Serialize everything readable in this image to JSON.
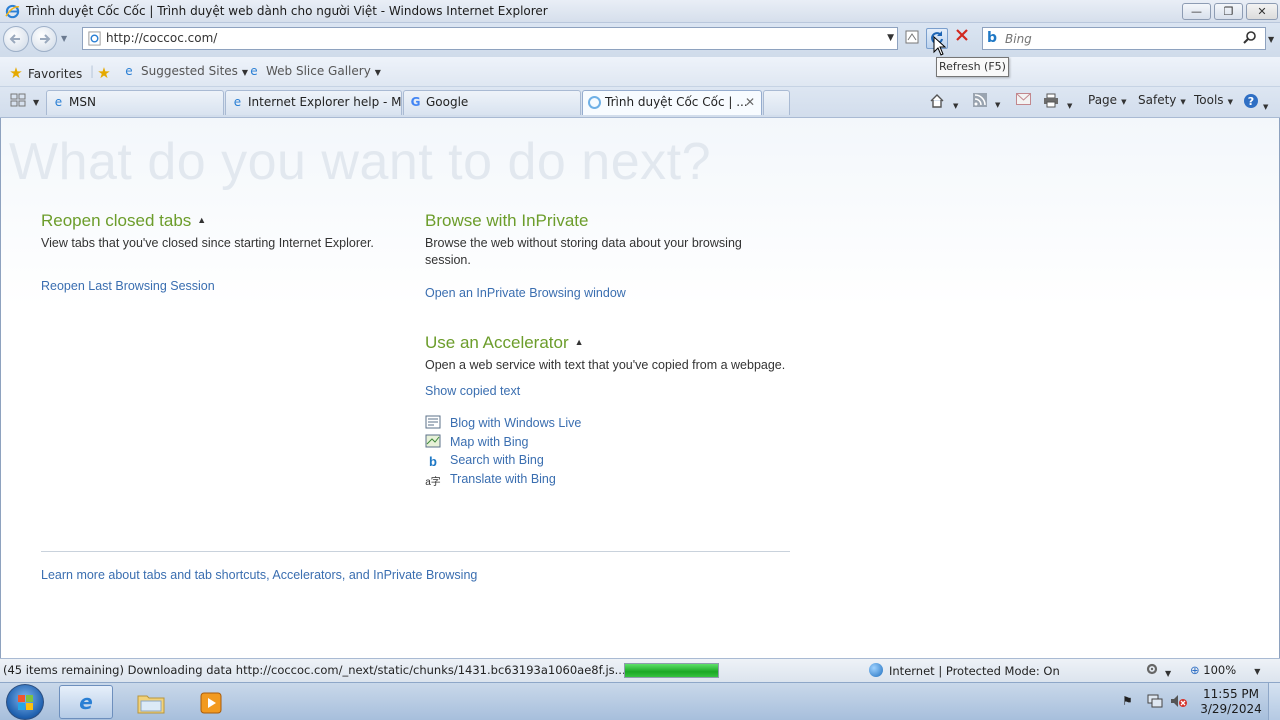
{
  "window": {
    "title": "Trình duyệt Cốc Cốc | Trình duyệt web dành cho người Việt - Windows Internet Explorer",
    "minimize_glyph": "—",
    "maximize_glyph": "❐",
    "close_glyph": "✕"
  },
  "address": {
    "url": "http://coccoc.com/",
    "search_placeholder": "Bing",
    "refresh_tooltip": "Refresh (F5)"
  },
  "favorites_bar": {
    "favorites_label": "Favorites",
    "items": [
      {
        "label": "Suggested Sites",
        "icon": "ie-page-icon"
      },
      {
        "label": "Web Slice Gallery",
        "icon": "ie-page-icon"
      }
    ]
  },
  "tabs": [
    {
      "label": "MSN",
      "icon": "ie-page-icon",
      "active": false
    },
    {
      "label": "Internet Explorer help - Mi...",
      "icon": "ie-page-icon",
      "active": false
    },
    {
      "label": "Google",
      "icon": "google-icon",
      "active": false
    },
    {
      "label": "Trình duyệt Cốc Cốc | ...",
      "icon": "loading-icon",
      "active": true
    }
  ],
  "command_bar": {
    "page_label": "Page",
    "safety_label": "Safety",
    "tools_label": "Tools"
  },
  "content": {
    "headline": "What do you want to do next?",
    "reopen": {
      "title": "Reopen closed tabs",
      "description": "View tabs that you've closed since starting Internet Explorer.",
      "link": "Reopen Last Browsing Session"
    },
    "inprivate": {
      "title": "Browse with InPrivate",
      "description": "Browse the web without storing data about your browsing session.",
      "link": "Open an InPrivate Browsing window"
    },
    "accelerator": {
      "title": "Use an Accelerator",
      "description": "Open a web service with text that you've copied from a webpage.",
      "show_link": "Show copied text",
      "items": [
        {
          "label": "Blog with Windows Live",
          "icon": "blog-icon"
        },
        {
          "label": "Map with Bing",
          "icon": "map-icon"
        },
        {
          "label": "Search with Bing",
          "icon": "bing-icon"
        },
        {
          "label": "Translate with Bing",
          "icon": "translate-icon"
        }
      ]
    },
    "footer_link": "Learn more about tabs and tab shortcuts, Accelerators, and InPrivate Browsing"
  },
  "status_bar": {
    "text": "(45 items remaining) Downloading data http://coccoc.com/_next/static/chunks/1431.bc63193a1060ae8f.js...",
    "progress": 1.0,
    "zone": "Internet | Protected Mode: On",
    "zoom": "100%"
  },
  "taskbar": {
    "time": "11:55 PM",
    "date": "3/29/2024"
  },
  "colors": {
    "section_title": "#6c9d2b",
    "link": "#3a6eb0",
    "progress_fill": "#1ba825"
  }
}
